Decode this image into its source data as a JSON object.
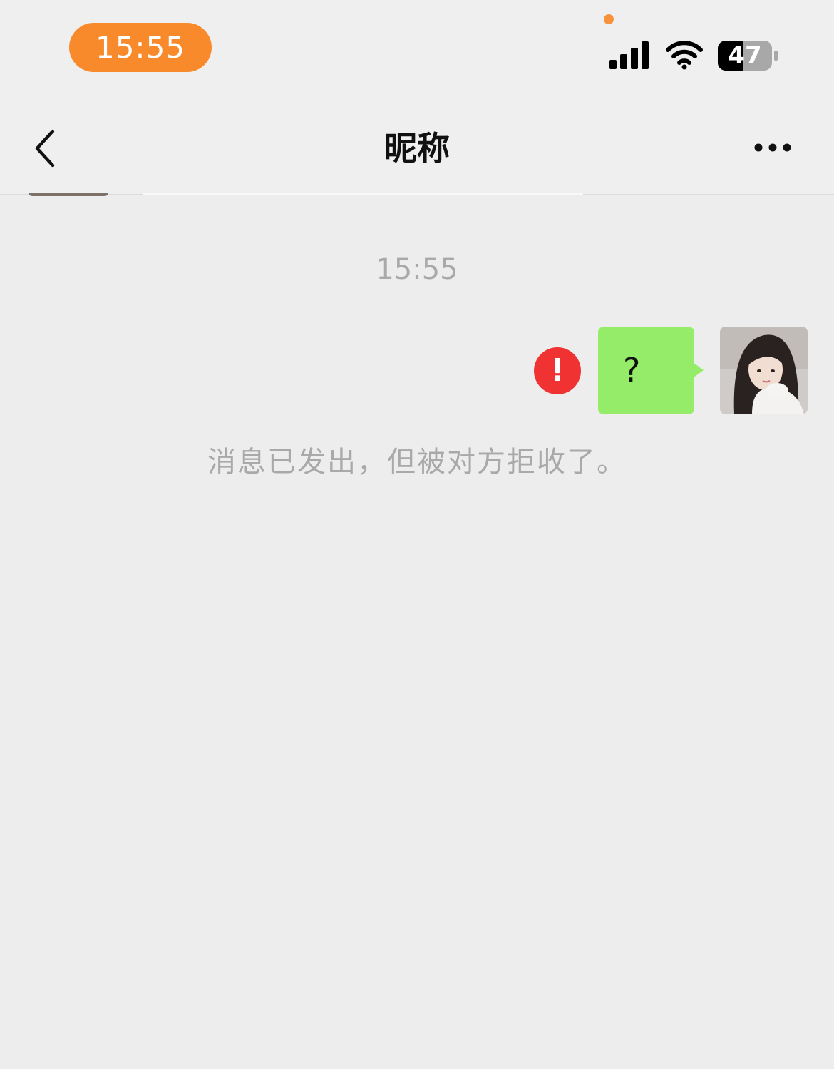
{
  "status_bar": {
    "time": "15:55",
    "battery_level": "47",
    "accent_color": "#f98a2c",
    "icons": [
      "privacy-dot",
      "signal-icon",
      "wifi-icon",
      "battery-icon"
    ]
  },
  "nav": {
    "title": "昵称",
    "back_icon": "chevron-left-icon",
    "more_icon": "more-dots-icon"
  },
  "chat": {
    "timestamp": "15:55",
    "message": {
      "text": "?",
      "status_icon": "!",
      "bubble_color": "#95ec69",
      "fail_color": "#f03232"
    },
    "system_notice": "消息已发出，但被对方拒收了。"
  }
}
